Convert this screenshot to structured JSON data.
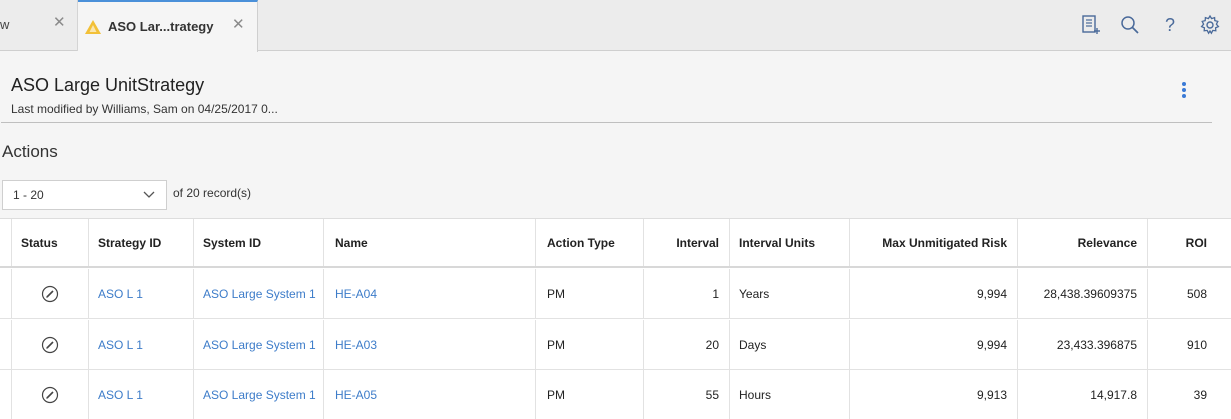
{
  "tabs": {
    "prev_label": "w",
    "active_label": "ASO Lar...trategy"
  },
  "toolbar": {
    "icons": [
      "add-record-icon",
      "search-icon",
      "help-icon",
      "settings-icon"
    ]
  },
  "header": {
    "title": "ASO Large UnitStrategy",
    "subtitle": "Last modified by Williams, Sam on 04/25/2017 0..."
  },
  "section": {
    "title": "Actions"
  },
  "pager": {
    "selected": "1 - 20",
    "records": "of 20 record(s)"
  },
  "table": {
    "columns": [
      "Status",
      "Strategy ID",
      "System ID",
      "Name",
      "Action Type",
      "Interval",
      "Interval Units",
      "Max Unmitigated Risk",
      "Relevance",
      "ROI"
    ],
    "rows": [
      {
        "strategy_id": "ASO L 1",
        "system_id": "ASO Large System 1",
        "name": "HE-A04",
        "action_type": "PM",
        "interval": "1",
        "interval_units": "Years",
        "max_risk": "9,994",
        "relevance": "28,438.39609375",
        "roi": "508"
      },
      {
        "strategy_id": "ASO L 1",
        "system_id": "ASO Large System 1",
        "name": "HE-A03",
        "action_type": "PM",
        "interval": "20",
        "interval_units": "Days",
        "max_risk": "9,994",
        "relevance": "23,433.396875",
        "roi": "910"
      },
      {
        "strategy_id": "ASO L 1",
        "system_id": "ASO Large System 1",
        "name": "HE-A05",
        "action_type": "PM",
        "interval": "55",
        "interval_units": "Hours",
        "max_risk": "9,913",
        "relevance": "14,917.8",
        "roi": "39"
      }
    ]
  },
  "colors": {
    "accent": "#3a7ad6",
    "link": "#3d7cc9",
    "warning": "#f2c037"
  }
}
